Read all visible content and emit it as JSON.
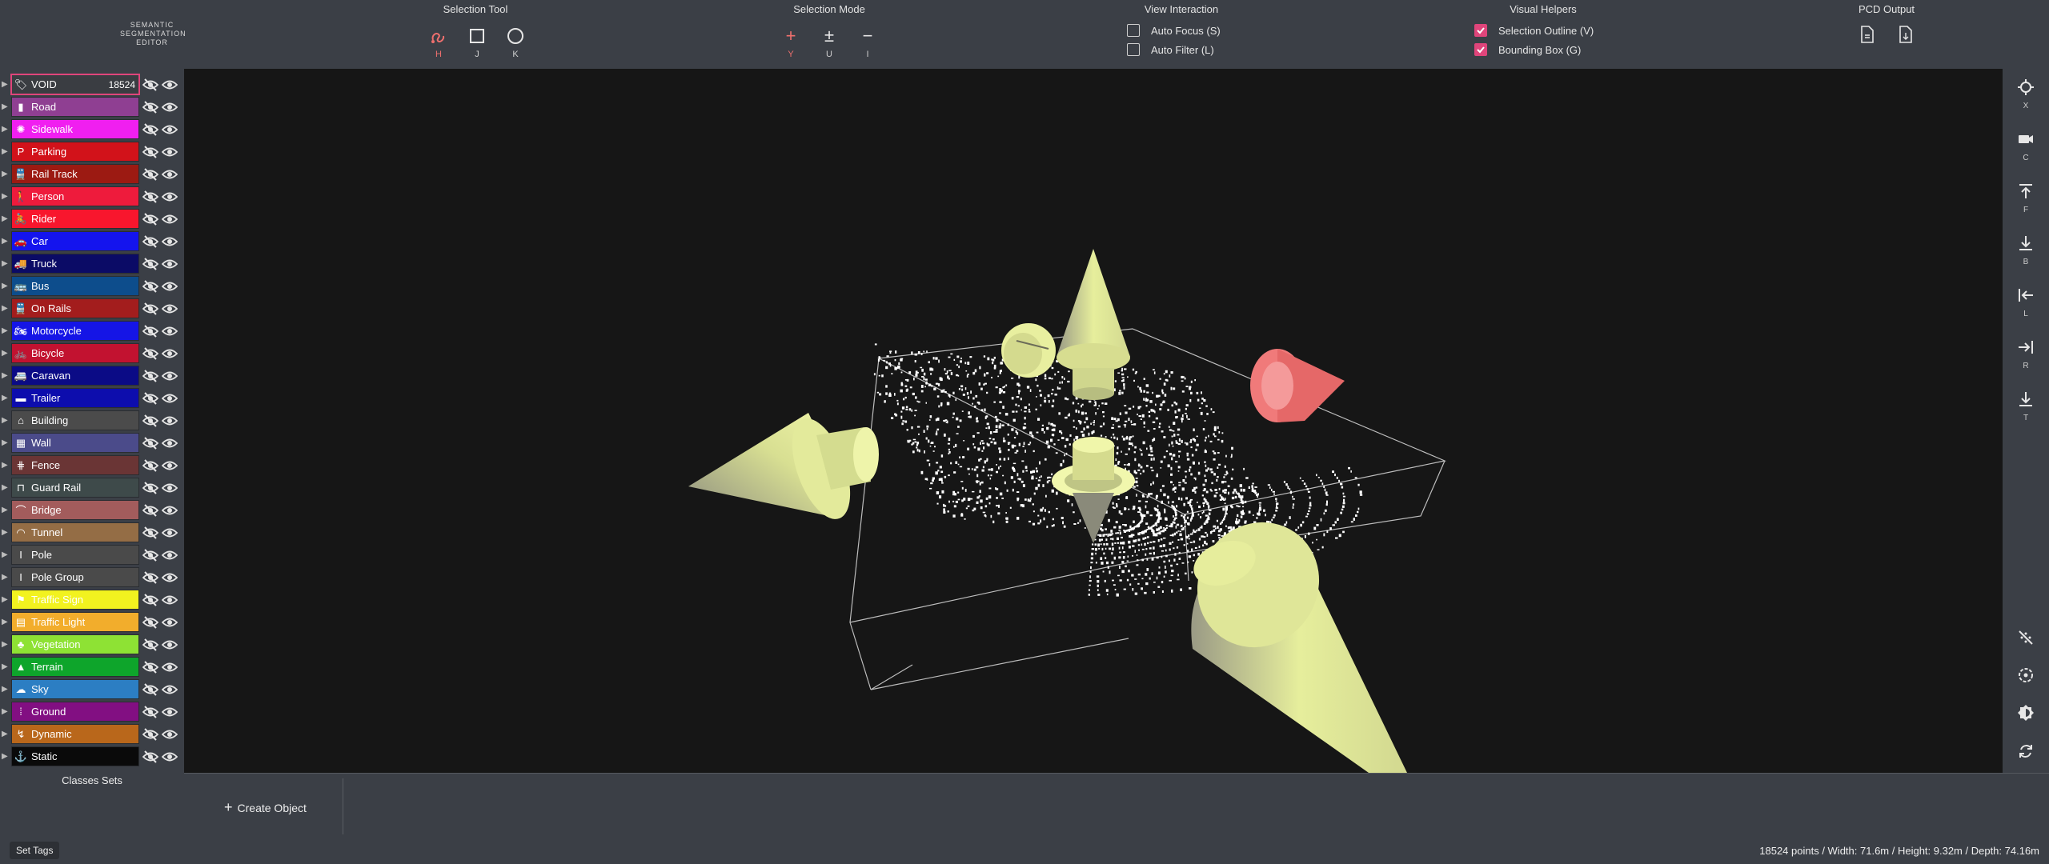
{
  "app": {
    "title_lines": [
      "SEMANTIC",
      "SEGMENTATION",
      "EDITOR"
    ]
  },
  "toolbar": {
    "selection_tool": {
      "title": "Selection Tool",
      "tools": [
        {
          "name": "lasso",
          "key": "H",
          "active": true
        },
        {
          "name": "box",
          "key": "J",
          "active": false
        },
        {
          "name": "circle",
          "key": "K",
          "active": false
        }
      ]
    },
    "selection_mode": {
      "title": "Selection Mode",
      "modes": [
        {
          "glyph": "+",
          "key": "Y",
          "active": true
        },
        {
          "glyph": "±",
          "key": "U",
          "active": false
        },
        {
          "glyph": "−",
          "key": "I",
          "active": false
        }
      ]
    },
    "view_interaction": {
      "title": "View Interaction",
      "options": [
        {
          "label": "Auto Focus (S)",
          "checked": false
        },
        {
          "label": "Auto Filter (L)",
          "checked": false
        }
      ]
    },
    "visual_helpers": {
      "title": "Visual Helpers",
      "options": [
        {
          "label": "Selection Outline (V)",
          "checked": true
        },
        {
          "label": "Bounding Box (G)",
          "checked": true
        }
      ]
    },
    "pcd_output": {
      "title": "PCD Output"
    }
  },
  "classes": [
    {
      "name": "VOID",
      "color": "#3a3d42",
      "icon": "tag",
      "count": "18524"
    },
    {
      "name": "Road",
      "color": "#8f3f92",
      "icon": "road"
    },
    {
      "name": "Sidewalk",
      "color": "#f01ff0",
      "icon": "walk"
    },
    {
      "name": "Parking",
      "color": "#d2121a",
      "icon": "parking"
    },
    {
      "name": "Rail Track",
      "color": "#9c1a12",
      "icon": "train"
    },
    {
      "name": "Person",
      "color": "#ee1b3c",
      "icon": "person"
    },
    {
      "name": "Rider",
      "color": "#f8162d",
      "icon": "rider"
    },
    {
      "name": "Car",
      "color": "#1414ee",
      "icon": "car"
    },
    {
      "name": "Truck",
      "color": "#0b0b66",
      "icon": "truck"
    },
    {
      "name": "Bus",
      "color": "#0d4d8c",
      "icon": "bus"
    },
    {
      "name": "On Rails",
      "color": "#a31d1d",
      "icon": "train"
    },
    {
      "name": "Motorcycle",
      "color": "#1515e6",
      "icon": "motorcycle"
    },
    {
      "name": "Bicycle",
      "color": "#c21230",
      "icon": "bicycle"
    },
    {
      "name": "Caravan",
      "color": "#0b0b86",
      "icon": "caravan"
    },
    {
      "name": "Trailer",
      "color": "#0d0dad",
      "icon": "trailer"
    },
    {
      "name": "Building",
      "color": "#4b4b4b",
      "icon": "building"
    },
    {
      "name": "Wall",
      "color": "#4b4b8a",
      "icon": "wall"
    },
    {
      "name": "Fence",
      "color": "#6a3535",
      "icon": "fence"
    },
    {
      "name": "Guard Rail",
      "color": "#3e4a4a",
      "icon": "guardrail"
    },
    {
      "name": "Bridge",
      "color": "#a35c5c",
      "icon": "bridge"
    },
    {
      "name": "Tunnel",
      "color": "#946d45",
      "icon": "tunnel"
    },
    {
      "name": "Pole",
      "color": "#4a4a4a",
      "icon": "pole"
    },
    {
      "name": "Pole Group",
      "color": "#4a4a4a",
      "icon": "pole"
    },
    {
      "name": "Traffic Sign",
      "color": "#f2f21f",
      "icon": "sign"
    },
    {
      "name": "Traffic Light",
      "color": "#f2ad2c",
      "icon": "light"
    },
    {
      "name": "Vegetation",
      "color": "#8ee234",
      "icon": "tree"
    },
    {
      "name": "Terrain",
      "color": "#0ea52b",
      "icon": "mountain"
    },
    {
      "name": "Sky",
      "color": "#2c7ec3",
      "icon": "sky"
    },
    {
      "name": "Ground",
      "color": "#820f82",
      "icon": "dots"
    },
    {
      "name": "Dynamic",
      "color": "#b9671b",
      "icon": "dynamic"
    },
    {
      "name": "Static",
      "color": "#0a0a0a",
      "icon": "anchor"
    }
  ],
  "class_sets_label": "Classes Sets",
  "right_tools": [
    {
      "icon": "crosshair-icon",
      "key": "X"
    },
    {
      "icon": "camera-icon",
      "key": "C"
    },
    {
      "icon": "view-front-icon",
      "key": "F"
    },
    {
      "icon": "view-back-icon",
      "key": "B"
    },
    {
      "icon": "view-left-icon",
      "key": "L"
    },
    {
      "icon": "view-right-icon",
      "key": "R"
    },
    {
      "icon": "view-top-icon",
      "key": "T"
    },
    {
      "icon": "hide-points-icon",
      "key": ""
    },
    {
      "icon": "target-icon",
      "key": ""
    },
    {
      "icon": "brightness-icon",
      "key": ""
    },
    {
      "icon": "rotate-icon",
      "key": ""
    }
  ],
  "bottom": {
    "create_object": "Create Object"
  },
  "status": {
    "set_tags": "Set Tags",
    "info": "18524 points / Width: 71.6m / Height: 9.32m / Depth: 74.16m"
  },
  "colors": {
    "accent": "#e0457b",
    "active_tool": "#f0706e",
    "gizmo": "#e6ee9c",
    "gizmo_red": "#f07a7a"
  }
}
